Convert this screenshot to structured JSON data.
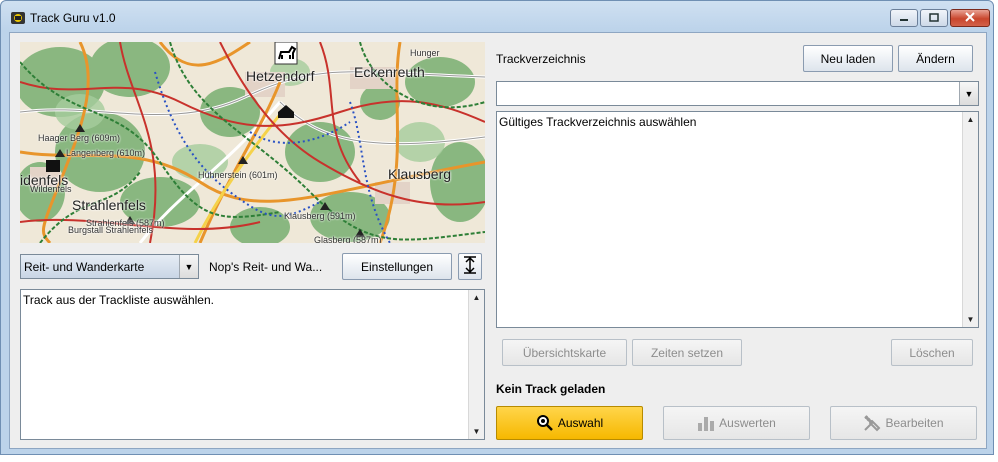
{
  "window": {
    "title": "Track Guru v1.0",
    "icons": [
      "app-icon",
      "minimize-icon",
      "maximize-icon",
      "close-icon"
    ]
  },
  "map": {
    "labels": {
      "hetzendorf": "Hetzendorf",
      "eckenreuth": "Eckenreuth",
      "hunger": "Hunger",
      "haager_berg": "Haager Berg (609m)",
      "langenberg": "Langenberg (610m)",
      "idenfels": "idenfels",
      "wildenfels": "Wildenfels",
      "strahlenfels": "Strahlenfels",
      "strahlenfels_peak": "Strahlenfels (587m)",
      "burgstall": "Burgstall Strahlenfels",
      "huehnerstein": "Hühnerstein (601m)",
      "klausberg": "Klausberg",
      "klausberg_peak": "Klausberg (591m)",
      "glasberg": "Glasberg (587m)"
    }
  },
  "map_controls": {
    "map_type": "Reit- und Wanderkarte",
    "map_source": "Nop's Reit- und Wa...",
    "settings_button": "Einstellungen"
  },
  "info": {
    "text": "Track aus der Trackliste auswählen."
  },
  "track_directory": {
    "label": "Trackverzeichnis",
    "reload_button": "Neu laden",
    "change_button": "Ändern",
    "selected": "",
    "list_text": "Gültiges Trackverzeichnis auswählen"
  },
  "actions": {
    "overview_map": "Übersichtskarte",
    "set_times": "Zeiten setzen",
    "delete": "Löschen"
  },
  "status": {
    "text": "Kein Track geladen"
  },
  "bottom_buttons": {
    "select": "Auswahl",
    "evaluate": "Auswerten",
    "edit": "Bearbeiten"
  },
  "colors": {
    "primary_button": "#f6b800",
    "close_button": "#c9462d",
    "titlebar": "#bcd3ea"
  }
}
